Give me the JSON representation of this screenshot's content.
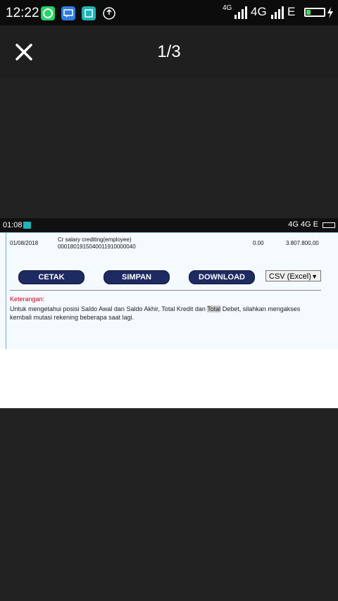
{
  "statusbar": {
    "time": "12:22",
    "network_left": "4G",
    "network_right": "4G",
    "network_extra": "E"
  },
  "viewer": {
    "page_indicator": "1/3"
  },
  "screenshot": {
    "status_time": "01:08",
    "status_network": "4G 4G E",
    "transaction": {
      "date": "01/08/2018",
      "description_line1": "Cr salary crediting(employee)",
      "description_line2": "0001801915040011910000040",
      "debit": "0.00",
      "credit": "3.807.800,00"
    },
    "buttons": {
      "print": "CETAK",
      "save": "SIMPAN",
      "download": "DOWNLOAD"
    },
    "format_select": {
      "value": "CSV (Excel)"
    },
    "note": {
      "title": "Keterangan:",
      "line1_a": "Untuk mengetahui posisi Saldo Awal dan Saldo Akhir, Total Kredit dan ",
      "line1_highlight": "Total",
      "line1_b": " Debet, silahkan mengakses",
      "line2": "kembali mutasi rekening beberapa saat lagi."
    }
  },
  "colors": {
    "button_bg": "#1e2b63",
    "note_title": "#d0021b",
    "viewer_bg": "#1f1f1f"
  }
}
